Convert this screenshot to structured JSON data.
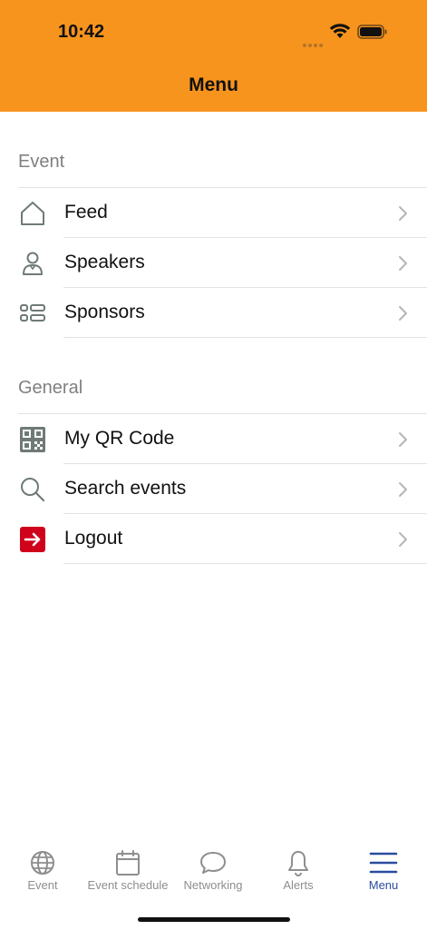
{
  "status_bar": {
    "time": "10:42"
  },
  "header": {
    "title": "Menu"
  },
  "colors": {
    "header_bg": "#F7941D",
    "accent": "#2B4C9F",
    "logout_red": "#D0021B",
    "icon_gray": "#6f7a76"
  },
  "sections": [
    {
      "title": "Event",
      "items": [
        {
          "label": "Feed",
          "icon": "home-icon"
        },
        {
          "label": "Speakers",
          "icon": "person-icon"
        },
        {
          "label": "Sponsors",
          "icon": "sponsors-list-icon"
        }
      ]
    },
    {
      "title": "General",
      "items": [
        {
          "label": "My QR Code",
          "icon": "qr-code-icon"
        },
        {
          "label": "Search events",
          "icon": "search-icon"
        },
        {
          "label": "Logout",
          "icon": "logout-icon"
        }
      ]
    }
  ],
  "tabbar": {
    "tabs": [
      {
        "label": "Event",
        "icon": "globe-icon",
        "active": false
      },
      {
        "label": "Event schedule",
        "icon": "calendar-icon",
        "active": false
      },
      {
        "label": "Networking",
        "icon": "chat-bubble-icon",
        "active": false
      },
      {
        "label": "Alerts",
        "icon": "bell-icon",
        "active": false
      },
      {
        "label": "Menu",
        "icon": "hamburger-menu-icon",
        "active": true
      }
    ]
  }
}
